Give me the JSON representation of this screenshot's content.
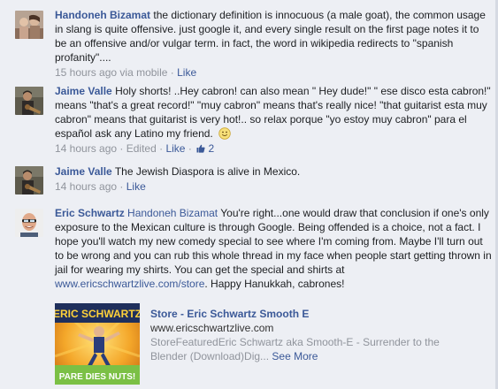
{
  "comments": [
    {
      "author": "Handoneh Bizamat",
      "text": "the dictionary definition is innocuous (a male goat), the common usage in slang is quite offensive. just google it, and every single result on the first page notes it to be an offensive and/or vulgar term. in fact, the word in wikipedia redirects to \"spanish profanity\"....",
      "time": "15 hours ago",
      "via": "via mobile",
      "sep": "·",
      "like": "Like"
    },
    {
      "author": "Jaime Valle",
      "text": "Holy shorts! ..Hey cabron! can also mean \" Hey dude!\" \" ese disco esta cabron!\" means \"that's a great record!\" \"muy cabron\" means that's really nice! \"that guitarist esta muy cabron\" means that guitarist is very hot!.. so relax porque \"yo estoy muy cabron\" para el español ask any Latino my friend.",
      "time": "14 hours ago",
      "edited": "Edited",
      "sep": "·",
      "like": "Like",
      "likes_count": "2"
    },
    {
      "author": "Jaime Valle",
      "text": "The Jewish Diaspora is alive in Mexico.",
      "time": "14 hours ago",
      "sep": "·",
      "like": "Like"
    },
    {
      "author": "Eric Schwartz",
      "mention": "Handoneh Bizamat",
      "text": "You're right...one would draw that conclusion if one's only exposure to the Mexican culture is through Google. Being offended is a choice, not a fact. I hope you'll watch my new comedy special to see where I'm coming from. Maybe I'll turn out to be wrong and you can rub this whole thread in my face when people start getting thrown in jail for wearing my shirts. You can get the special and shirts at",
      "link": "www.ericschwartzlive.com/store",
      "text_after": ". Happy Hanukkah, cabrones!"
    }
  ],
  "share": {
    "title": "Store - Eric Schwartz Smooth E",
    "url": "www.ericschwartzlive.com",
    "description": "StoreFeaturedEric Schwartz aka Smooth-E - Surrender to the Blender (Download)Dig...",
    "see_more": "See More",
    "image_text_top": "ERIC SCHWARTZ",
    "image_text_bottom": "PARE DIES NUTS!"
  },
  "colors": {
    "link": "#3b5998",
    "meta": "#90949c",
    "background": "#edeff4"
  }
}
